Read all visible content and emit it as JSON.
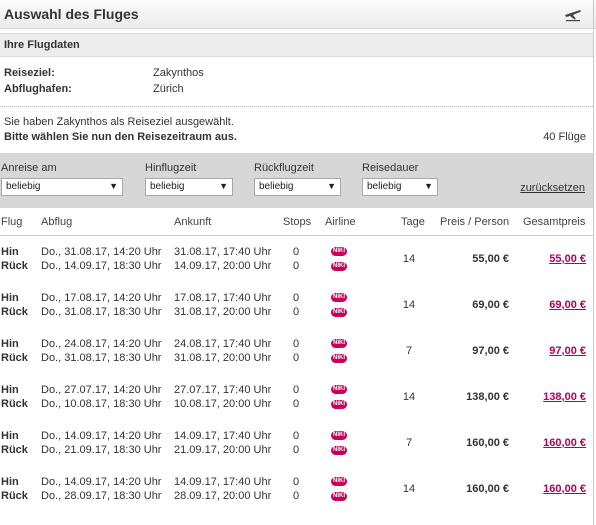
{
  "header": {
    "title": "Auswahl des Fluges",
    "icon": "airplane-icon"
  },
  "flugdaten": {
    "heading": "Ihre Flugdaten",
    "reiseziel_label": "Reiseziel:",
    "reiseziel_value": "Zakynthos",
    "abflughafen_label": "Abflughafen:",
    "abflughafen_value": "Zürich"
  },
  "info": {
    "line1": "Sie haben Zakynthos als Reiseziel ausgewählt.",
    "line2": "Bitte wählen Sie nun den Reisezeitraum aus.",
    "count": "40 Flüge"
  },
  "filters": {
    "anreise_label": "Anreise am",
    "anreise_value": "beliebig",
    "hinflugzeit_label": "Hinflugzeit",
    "hinflugzeit_value": "beliebig",
    "rueckflugzeit_label": "Rückflugzeit",
    "rueckflugzeit_value": "beliebig",
    "reisedauer_label": "Reisedauer",
    "reisedauer_value": "beliebig",
    "reset_label": "zurücksetzen"
  },
  "table": {
    "headers": {
      "flug": "Flug",
      "abflug": "Abflug",
      "ankunft": "Ankunft",
      "stops": "Stops",
      "airline": "Airline",
      "tage": "Tage",
      "preis": "Preis / Person",
      "gesamt": "Gesamtpreis"
    },
    "airline_logo_text": "NIKI",
    "rows": [
      {
        "hin": "Hin",
        "rueck": "Rück",
        "dep1": "Do., 31.08.17, 14:20 Uhr",
        "dep2": "Do., 14.09.17, 18:30 Uhr",
        "arr1": "31.08.17, 17:40 Uhr",
        "arr2": "14.09.17, 20:00 Uhr",
        "stops1": "0",
        "stops2": "0",
        "tage": "14",
        "preis": "55,00 €",
        "gesamt": "55,00 €"
      },
      {
        "hin": "Hin",
        "rueck": "Rück",
        "dep1": "Do., 17.08.17, 14:20 Uhr",
        "dep2": "Do., 31.08.17, 18:30 Uhr",
        "arr1": "17.08.17, 17:40 Uhr",
        "arr2": "31.08.17, 20:00 Uhr",
        "stops1": "0",
        "stops2": "0",
        "tage": "14",
        "preis": "69,00 €",
        "gesamt": "69,00 €"
      },
      {
        "hin": "Hin",
        "rueck": "Rück",
        "dep1": "Do., 24.08.17, 14:20 Uhr",
        "dep2": "Do., 31.08.17, 18:30 Uhr",
        "arr1": "24.08.17, 17:40 Uhr",
        "arr2": "31.08.17, 20:00 Uhr",
        "stops1": "0",
        "stops2": "0",
        "tage": "7",
        "preis": "97,00 €",
        "gesamt": "97,00 €"
      },
      {
        "hin": "Hin",
        "rueck": "Rück",
        "dep1": "Do., 27.07.17, 14:20 Uhr",
        "dep2": "Do., 10.08.17, 18:30 Uhr",
        "arr1": "27.07.17, 17:40 Uhr",
        "arr2": "10.08.17, 20:00 Uhr",
        "stops1": "0",
        "stops2": "0",
        "tage": "14",
        "preis": "138,00 €",
        "gesamt": "138,00 €"
      },
      {
        "hin": "Hin",
        "rueck": "Rück",
        "dep1": "Do., 14.09.17, 14:20 Uhr",
        "dep2": "Do., 21.09.17, 18:30 Uhr",
        "arr1": "14.09.17, 17:40 Uhr",
        "arr2": "21.09.17, 20:00 Uhr",
        "stops1": "0",
        "stops2": "0",
        "tage": "7",
        "preis": "160,00 €",
        "gesamt": "160,00 €"
      },
      {
        "hin": "Hin",
        "rueck": "Rück",
        "dep1": "Do., 14.09.17, 14:20 Uhr",
        "dep2": "Do., 28.09.17, 18:30 Uhr",
        "arr1": "14.09.17, 17:40 Uhr",
        "arr2": "28.09.17, 20:00 Uhr",
        "stops1": "0",
        "stops2": "0",
        "tage": "14",
        "preis": "160,00 €",
        "gesamt": "160,00 €"
      }
    ]
  },
  "colors": {
    "accent": "#b4005a",
    "filterbar": "#d7d7d7"
  }
}
